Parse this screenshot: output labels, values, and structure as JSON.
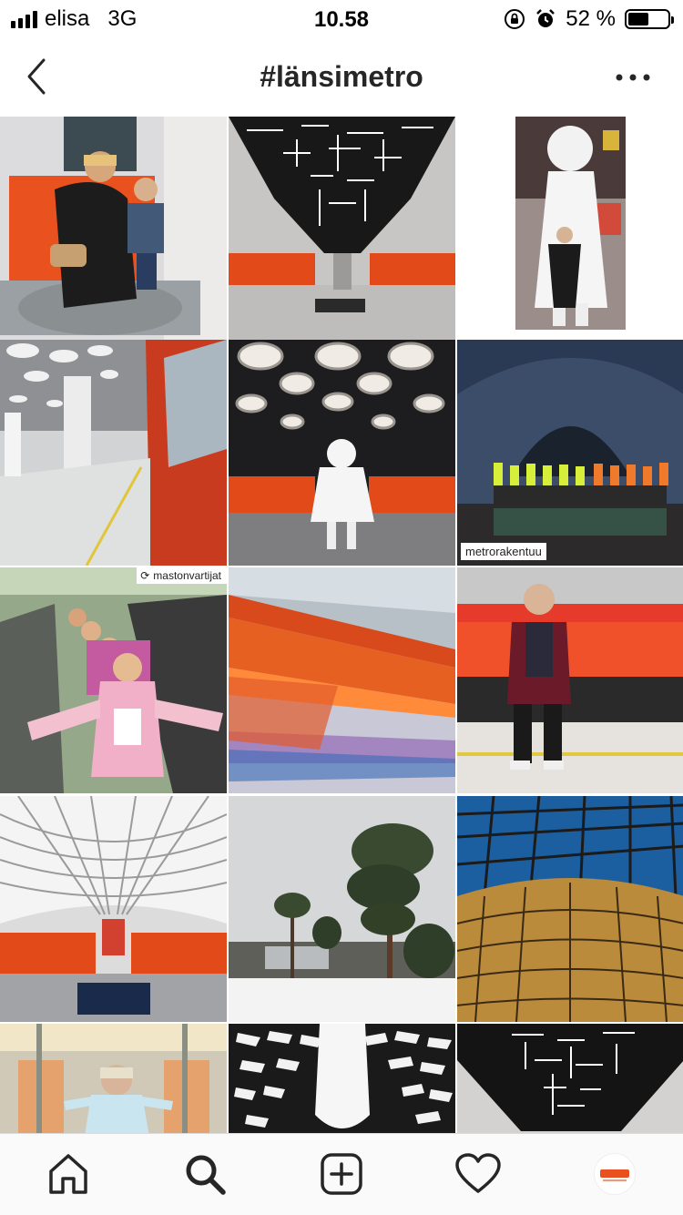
{
  "status_bar": {
    "carrier": "elisa",
    "network": "3G",
    "time": "10.58",
    "battery_percent": "52 %",
    "battery_level": 0.52,
    "signal_bars": 4
  },
  "header": {
    "title": "#länsimetro",
    "back_icon": "chevron-left-icon",
    "more_icon": "more-dots-icon"
  },
  "grid": {
    "posts": [
      {
        "name": "Woman and boy on orange metro seat"
      },
      {
        "name": "Station with linear ceiling lights"
      },
      {
        "name": "White girl statue with visitor"
      },
      {
        "name": "Platform with white ceiling discs"
      },
      {
        "name": "Station ceiling discs with statue"
      },
      {
        "name": "Tunnel construction workers",
        "caption": "metrorakentuu"
      },
      {
        "name": "Children on escalator",
        "repost_user": "mastonvartijat"
      },
      {
        "name": "Orange train motion blur"
      },
      {
        "name": "Man in front of moving red train"
      },
      {
        "name": "Station with patterned ceiling"
      },
      {
        "name": "Snowy pine landscape"
      },
      {
        "name": "Glass dome roof"
      },
      {
        "name": "Woman inside metro car"
      },
      {
        "name": "Black and white tiled ceiling"
      },
      {
        "name": "Dark ceiling with light strips"
      }
    ]
  },
  "tab_bar": {
    "tabs": [
      {
        "icon": "home-icon"
      },
      {
        "icon": "search-icon"
      },
      {
        "icon": "add-post-icon"
      },
      {
        "icon": "activity-heart-icon"
      },
      {
        "icon": "profile-icon"
      }
    ],
    "active_tab": "search-icon"
  },
  "colors": {
    "metro_orange": "#e8501f",
    "text_dark": "#262626"
  }
}
